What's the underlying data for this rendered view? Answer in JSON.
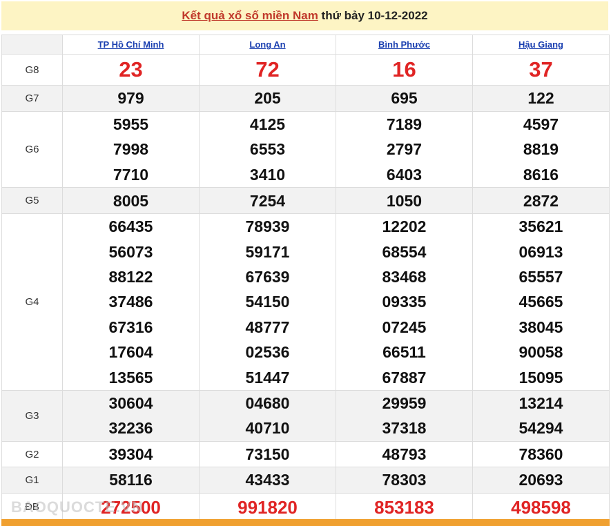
{
  "header": {
    "title_link": "Kết quả xổ số miền Nam",
    "title_rest": " thứ bảy 10-12-2022"
  },
  "provinces": [
    "TP Hồ Chí Minh",
    "Long An",
    "Bình Phước",
    "Hậu Giang"
  ],
  "prizes": [
    {
      "label": "G8",
      "values": [
        [
          "23"
        ],
        [
          "72"
        ],
        [
          "16"
        ],
        [
          "37"
        ]
      ]
    },
    {
      "label": "G7",
      "values": [
        [
          "979"
        ],
        [
          "205"
        ],
        [
          "695"
        ],
        [
          "122"
        ]
      ]
    },
    {
      "label": "G6",
      "values": [
        [
          "5955",
          "7998",
          "7710"
        ],
        [
          "4125",
          "6553",
          "3410"
        ],
        [
          "7189",
          "2797",
          "6403"
        ],
        [
          "4597",
          "8819",
          "8616"
        ]
      ]
    },
    {
      "label": "G5",
      "values": [
        [
          "8005"
        ],
        [
          "7254"
        ],
        [
          "1050"
        ],
        [
          "2872"
        ]
      ]
    },
    {
      "label": "G4",
      "values": [
        [
          "66435",
          "56073",
          "88122",
          "37486",
          "67316",
          "17604",
          "13565"
        ],
        [
          "78939",
          "59171",
          "67639",
          "54150",
          "48777",
          "02536",
          "51447"
        ],
        [
          "12202",
          "68554",
          "83468",
          "09335",
          "07245",
          "66511",
          "67887"
        ],
        [
          "35621",
          "06913",
          "65557",
          "45665",
          "38045",
          "90058",
          "15095"
        ]
      ]
    },
    {
      "label": "G3",
      "values": [
        [
          "30604",
          "32236"
        ],
        [
          "04680",
          "40710"
        ],
        [
          "29959",
          "37318"
        ],
        [
          "13214",
          "54294"
        ]
      ]
    },
    {
      "label": "G2",
      "values": [
        [
          "39304"
        ],
        [
          "73150"
        ],
        [
          "48793"
        ],
        [
          "78360"
        ]
      ]
    },
    {
      "label": "G1",
      "values": [
        [
          "58116"
        ],
        [
          "43433"
        ],
        [
          "78303"
        ],
        [
          "20693"
        ]
      ]
    },
    {
      "label": "ĐB",
      "values": [
        [
          "272500"
        ],
        [
          "991820"
        ],
        [
          "853183"
        ],
        [
          "498598"
        ]
      ]
    }
  ],
  "watermark": "BAOQUOCTE.VN"
}
